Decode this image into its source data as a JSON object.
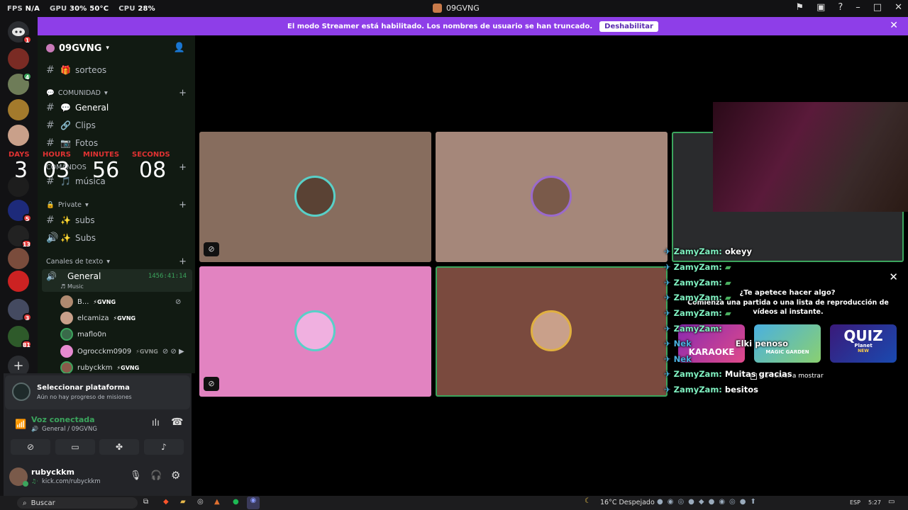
{
  "topbar": {
    "fps_label": "FPS",
    "fps_value": "N/A",
    "gpu_label": "GPU",
    "gpu_value": "30% 50°C",
    "cpu_label": "CPU",
    "cpu_value": "28%",
    "window_title": "09GVNG"
  },
  "banner": {
    "text": "El modo Streamer está habilitado. Los nombres de usuario se han truncado.",
    "button": "Deshabilitar"
  },
  "servers": {
    "badges": [
      "1",
      "4",
      "5",
      "13",
      "3",
      "81"
    ]
  },
  "server_header": {
    "name": "09GVNG"
  },
  "channels": {
    "sorteos": "sorteos",
    "cat_comunidad": "COMUNIDAD",
    "general": "General",
    "clips": "Clips",
    "fotos": "Fotos",
    "cat_comandos": "COMANDOS",
    "musica": "música",
    "cat_private": "Private",
    "subs": "subs",
    "subs2": "Subs",
    "cat_texto": "Canales de texto",
    "voice_general": "General",
    "voice_timer": "1456:41:14",
    "voice_activity": "Music"
  },
  "voice_users": [
    {
      "name": "B...",
      "tag": "GVNG"
    },
    {
      "name": "elcamiza",
      "tag": "GVNG"
    },
    {
      "name": "maflo0n",
      "tag": ""
    },
    {
      "name": "Ogrocckm0909",
      "tag": "GVNG"
    },
    {
      "name": "rubyckkm",
      "tag": "GVNG"
    }
  ],
  "countdown": {
    "days_label": "DAYS",
    "hours_label": "HOURS",
    "minutes_label": "MINUTES",
    "seconds_label": "SECONDS",
    "days": "3",
    "hours": "03",
    "minutes": "56",
    "seconds": "08"
  },
  "platform": {
    "title": "Seleccionar plataforma",
    "subtitle": "Aún no hay progreso de misiones"
  },
  "voice_status": {
    "title": "Voz conectada",
    "subtitle": "General / 09GVNG"
  },
  "user_panel": {
    "name": "rubyckkm",
    "status": "kick.com/rubyckkm"
  },
  "activity_popup": {
    "title": "¿Te apetece hacer algo?",
    "body": "Comienza una partida o una lista de reproducción de vídeos al instante.",
    "game1": "KARAOKE",
    "game2": "MAGIC GARDEN",
    "game3": "QUIZ",
    "game3_sub": "Planet",
    "game3_badge": "NEW",
    "dont_show": "No volver a mostrar"
  },
  "chat": [
    {
      "user": "ZamyZam:",
      "msg": "okeyy"
    },
    {
      "user": "ZamyZam:",
      "msg": ""
    },
    {
      "user": "ZamyZam:",
      "msg": ""
    },
    {
      "user": "ZamyZam:",
      "msg": ""
    },
    {
      "user": "ZamyZam:",
      "msg": ""
    },
    {
      "user": "ZamyZam:",
      "msg": ""
    },
    {
      "user": "Nek",
      "msg": "Elki penoso"
    },
    {
      "user": "Nek",
      "msg": ""
    },
    {
      "user": "ZamyZam:",
      "msg": "Muitas gracias"
    },
    {
      "user": "ZamyZam:",
      "msg": "besitos"
    }
  ],
  "taskbar": {
    "search": "Buscar",
    "weather": "16°C  Despejado",
    "lang": "ESP",
    "time": "5:27"
  },
  "colors": {
    "accent": "#8e3ee8",
    "speaking": "#3ba55d",
    "badge": "#e23b3b"
  }
}
